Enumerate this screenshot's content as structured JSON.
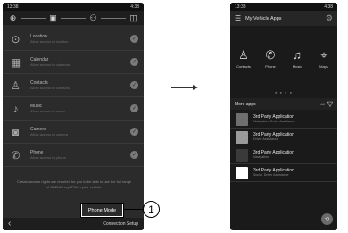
{
  "left": {
    "status": {
      "time": "13:38",
      "signal": "4G",
      "right": "4:38"
    },
    "steps": [
      {
        "icon": "globe-icon",
        "glyph": "⊕"
      },
      {
        "icon": "phone-icon",
        "glyph": "▣"
      },
      {
        "icon": "person-icon",
        "glyph": "⚇"
      },
      {
        "icon": "car-icon",
        "glyph": "◫"
      }
    ],
    "permissions": [
      {
        "title": "Location",
        "desc": "Allow access to location",
        "icon": "location-icon",
        "glyph": "⊙"
      },
      {
        "title": "Calendar",
        "desc": "Allow access to calendar",
        "icon": "calendar-icon",
        "glyph": "▦"
      },
      {
        "title": "Contacts",
        "desc": "Allow access to contacts",
        "icon": "contacts-icon",
        "glyph": "♙"
      },
      {
        "title": "Music",
        "desc": "Allow access to music",
        "icon": "music-icon",
        "glyph": "♪"
      },
      {
        "title": "Camera",
        "desc": "Allow access to camera",
        "icon": "camera-icon",
        "glyph": "◙"
      },
      {
        "title": "Phone",
        "desc": "Allow access to phone",
        "icon": "phone-call-icon",
        "glyph": "✆"
      }
    ],
    "check_glyph": "✓",
    "disclaimer": "Certain access rights are required for you to be able to use the full range of SUZUKI mySPIN in your vehicle.",
    "back_glyph": "‹",
    "connection_setup": "Connection Setup",
    "phone_mode": "Phone Mode",
    "callout": "1"
  },
  "right": {
    "status": {
      "time": "13:38",
      "right": "4:38"
    },
    "menu_glyph": "☰",
    "title": "My Vehicle Apps",
    "gear_glyph": "⚙",
    "favorites": [
      {
        "label": "Contacts",
        "icon": "contacts-icon",
        "glyph": "♙"
      },
      {
        "label": "Phone",
        "icon": "phone-icon",
        "glyph": "✆"
      },
      {
        "label": "Music",
        "icon": "music-icon",
        "glyph": "♫"
      },
      {
        "label": "Maps",
        "icon": "map-pin-icon",
        "glyph": "⌖"
      }
    ],
    "page_dots": "● ● ● ●",
    "more_apps": "More apps",
    "all_label": "All",
    "filter_glyph": "▽",
    "apps": [
      {
        "name": "3rd Party Application",
        "category": "Navigation, Driver Assistance",
        "color": "#6e6e6e"
      },
      {
        "name": "3rd Party Application",
        "category": "Driver Assistance",
        "color": "#9a9a9a"
      },
      {
        "name": "3rd Party Application",
        "category": "Navigation",
        "color": "#3a3a3a"
      },
      {
        "name": "3rd Party Application",
        "category": "Social, Driver Assistance",
        "color": "#ffffff"
      }
    ],
    "fab_glyph": "⟲"
  }
}
